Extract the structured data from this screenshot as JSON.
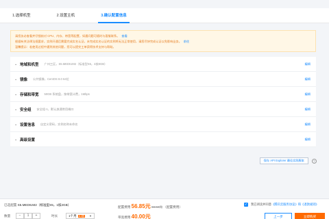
{
  "steps": [
    {
      "label": "1.选择机型",
      "active": false
    },
    {
      "label": "2.设置主机",
      "active": false
    },
    {
      "label": "3.确认配置信息",
      "active": true
    }
  ],
  "notice": {
    "lines": [
      {
        "text": "请您务必查看并仔细核对 CPU、内存、带宽等配置，如遇问题可随时与客服联系。",
        "link": "查看"
      },
      {
        "text": "根据有关法律法规要求，实例开通后需要完成实名认证，未完成实名认证的实例将无法正常使用，请您尽快完成认证以免影响业务。",
        "link": "前往"
      },
      {
        "text": "温馨提示：若使用过程中遇到其他问题，您可以提交工单获得技术支持与帮助。",
        "link": ""
      }
    ]
  },
  "sections": [
    {
      "title": "地域和机型",
      "summary": "广州三区，S5.MEDIUM2（标准型S5，4核8GB）",
      "edit": "编辑"
    },
    {
      "title": "镜像",
      "summary": "公共镜像，CentOS 8.0 64位",
      "edit": "编辑"
    },
    {
      "title": "存储和带宽",
      "summary": "50GB 系统盘，按带宽计费，1Mbps",
      "edit": "编辑"
    },
    {
      "title": "安全组",
      "summary": "安全组-1，默认放通常用端口",
      "edit": "编辑"
    },
    {
      "title": "设置信息",
      "summary": "自定义密码，实例名称未命名",
      "edit": "编辑"
    },
    {
      "title": "高级设置",
      "summary": "",
      "edit": "编辑"
    }
  ],
  "save_template_label": "保存 API Explorer 最佳实践脚本",
  "footer": {
    "config_label": "已选配置",
    "config_value": "S5.MEDIUM2（标准型S5，1核2GB）",
    "qty_label": "数量",
    "qty_value": "1",
    "term_label": "时长",
    "term_value": "1个月",
    "term_discount": "8.3折",
    "fee_label": "配置费用",
    "fee_value": "56.85元",
    "fee_original": "68.50元",
    "fee_note": "（配置费用）",
    "bandwidth_label": "带宽费用",
    "bandwidth_value": "40.00元",
    "agree_text": "我已阅读并同意",
    "agree_link": "《腾讯云服务协议》和《退款规则》",
    "prev_label": "上一步",
    "create_label": "立即购买"
  },
  "colors": {
    "accent": "#1a8cff",
    "orange": "#ff6a00",
    "notice_bg": "#fff7e6"
  }
}
